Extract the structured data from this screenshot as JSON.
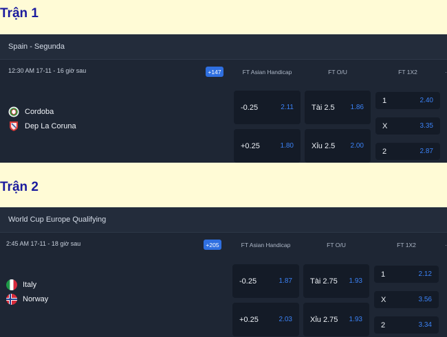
{
  "matches": [
    {
      "section_title": "Trận 1",
      "league": "Spain - Segunda",
      "meta": "12:30 AM 17-11 - 16 giờ sau",
      "more_count": "+147",
      "col_heads": [
        "FT Asian Handicap",
        "FT O/U",
        "FT 1X2"
      ],
      "teams": [
        {
          "name": "Cordoba",
          "icon": "cordoba-crest-icon"
        },
        {
          "name": "Dep La Coruna",
          "icon": "dep-la-coruna-crest-icon"
        }
      ],
      "handicap": [
        {
          "label": "-0.25",
          "odd": "2.11"
        },
        {
          "label": "+0.25",
          "odd": "1.80"
        }
      ],
      "ou": [
        {
          "label": "Tài 2.5",
          "odd": "1.86"
        },
        {
          "label": "Xỉu 2.5",
          "odd": "2.00"
        }
      ],
      "x12": [
        {
          "label": "1",
          "odd": "2.40"
        },
        {
          "label": "X",
          "odd": "3.35"
        },
        {
          "label": "2",
          "odd": "2.87"
        }
      ]
    },
    {
      "section_title": "Trận 2",
      "league": "World Cup Europe Qualifying",
      "meta": "2:45 AM 17-11 - 18 giờ sau",
      "more_count": "+205",
      "col_heads": [
        "FT Asian Handicap",
        "FT O/U",
        "FT 1X2"
      ],
      "teams": [
        {
          "name": "Italy",
          "icon": "italy-flag-icon"
        },
        {
          "name": "Norway",
          "icon": "norway-flag-icon"
        }
      ],
      "handicap": [
        {
          "label": "-0.25",
          "odd": "1.87"
        },
        {
          "label": "+0.25",
          "odd": "2.03"
        }
      ],
      "ou": [
        {
          "label": "Tài 2.75",
          "odd": "1.93"
        },
        {
          "label": "Xỉu 2.75",
          "odd": "1.93"
        }
      ],
      "x12": [
        {
          "label": "1",
          "odd": "2.12"
        },
        {
          "label": "X",
          "odd": "3.56"
        },
        {
          "label": "2",
          "odd": "3.34"
        }
      ]
    }
  ],
  "colors": {
    "page_bg": "#fffbd6",
    "section_title": "#1a1a9e",
    "panel_bg": "#1e2634",
    "cell_bg": "#141b27",
    "odd_blue": "#3b82f6",
    "badge_blue": "#2f6fe0"
  }
}
